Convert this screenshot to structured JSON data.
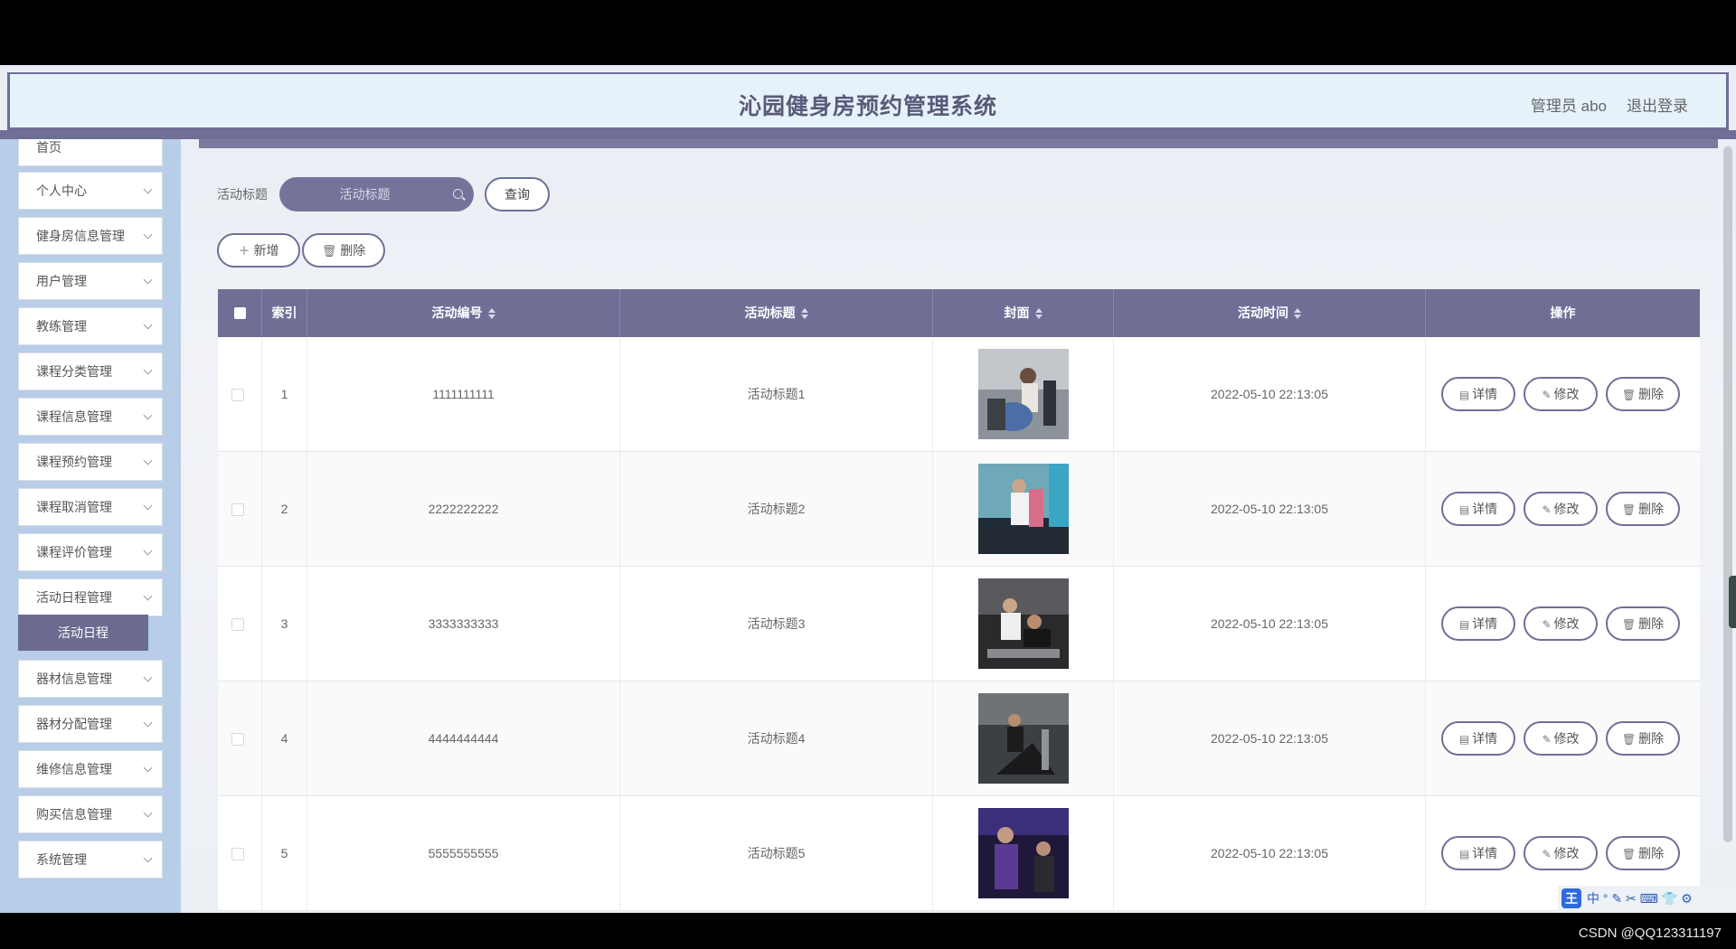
{
  "header": {
    "title": "沁园健身房预约管理系统",
    "user": "管理员 abo",
    "logout": "退出登录"
  },
  "sidebar": {
    "items": [
      {
        "label": "首页"
      },
      {
        "label": "个人中心"
      },
      {
        "label": "健身房信息管理"
      },
      {
        "label": "用户管理"
      },
      {
        "label": "教练管理"
      },
      {
        "label": "课程分类管理"
      },
      {
        "label": "课程信息管理"
      },
      {
        "label": "课程预约管理"
      },
      {
        "label": "课程取消管理"
      },
      {
        "label": "课程评价管理"
      },
      {
        "label": "活动日程管理"
      },
      {
        "label": "器材信息管理"
      },
      {
        "label": "器材分配管理"
      },
      {
        "label": "维修信息管理"
      },
      {
        "label": "购买信息管理"
      },
      {
        "label": "系统管理"
      }
    ],
    "active_sub": "活动日程"
  },
  "search": {
    "label": "活动标题",
    "placeholder": "活动标题",
    "query_button": "查询"
  },
  "toolbar": {
    "add": "新增",
    "delete": "删除"
  },
  "table": {
    "headers": {
      "index": "索引",
      "code": "活动编号",
      "title": "活动标题",
      "cover": "封面",
      "time": "活动时间",
      "ops": "操作"
    },
    "rows": [
      {
        "index": "1",
        "code": "1111111111",
        "title": "活动标题1",
        "time": "2022-05-10 22:13:05"
      },
      {
        "index": "2",
        "code": "2222222222",
        "title": "活动标题2",
        "time": "2022-05-10 22:13:05"
      },
      {
        "index": "3",
        "code": "3333333333",
        "title": "活动标题3",
        "time": "2022-05-10 22:13:05"
      },
      {
        "index": "4",
        "code": "4444444444",
        "title": "活动标题4",
        "time": "2022-05-10 22:13:05"
      },
      {
        "index": "5",
        "code": "5555555555",
        "title": "活动标题5",
        "time": "2022-05-10 22:13:05"
      }
    ],
    "actions": {
      "detail": "详情",
      "edit": "修改",
      "delete": "删除"
    }
  },
  "ime": {
    "label": "中"
  },
  "watermark": "CSDN @QQ123311197",
  "colors": {
    "accent": "#6f6f96",
    "sidebar": "#b7cde8",
    "header_bg": "#e6f2fa"
  }
}
